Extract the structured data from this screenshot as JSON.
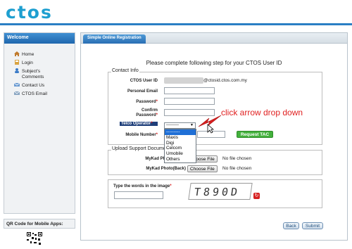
{
  "app": {
    "logo_text": "ctos"
  },
  "sidebar": {
    "header": "Welcome",
    "items": [
      {
        "label": "Home",
        "icon": "home-icon"
      },
      {
        "label": "Login",
        "icon": "login-icon"
      },
      {
        "label": "Subject's Comments",
        "label_line1": "Subject's",
        "label_line2": "Comments",
        "icon": "comments-icon"
      },
      {
        "label": "Contact Us",
        "icon": "contact-icon"
      },
      {
        "label": "CTOS Email",
        "icon": "email-icon"
      }
    ],
    "qr_label": "QR Code for Mobile Apps:"
  },
  "main": {
    "tab": "Simple Online Registration",
    "instruction": "Please complete following step for your CTOS User ID",
    "contact_info": {
      "legend": "Contact Info",
      "user_id_label": "CTOS User ID",
      "user_id_value": "@ctosid.ctos.com.my",
      "personal_email_label": "Personal Email",
      "password_label": "Password",
      "confirm_password_label_1": "Confirm",
      "confirm_password_label_2": "Password",
      "telco_label": "Telco Operator",
      "telco_selected": "---------",
      "telco_options": [
        "---------",
        "Maxis",
        "Digi",
        "Celcom",
        "Umobile",
        "Others"
      ],
      "mobile_label": "Mobile Number",
      "request_tac": "Request TAC",
      "required_mark": "*"
    },
    "upload": {
      "legend": "Upload Support Document (Optional)",
      "mykad_front_label": "MyKad Photo(Front)",
      "mykad_back_label": "MyKad Photo(Back)",
      "choose_file": "Choose File",
      "no_file": "No file chosen"
    },
    "captcha": {
      "label": "Type the words in the image",
      "code": "T890D",
      "refresh_symbol": "↻"
    },
    "buttons": {
      "back": "Back",
      "submit": "Submit"
    }
  },
  "annotation": {
    "text": "click arrow drop down"
  },
  "colors": {
    "brand": "#1e9fd0",
    "header_blue": "#2a6eb3",
    "tac_green": "#43b13c",
    "annotation_red": "#e02020"
  }
}
